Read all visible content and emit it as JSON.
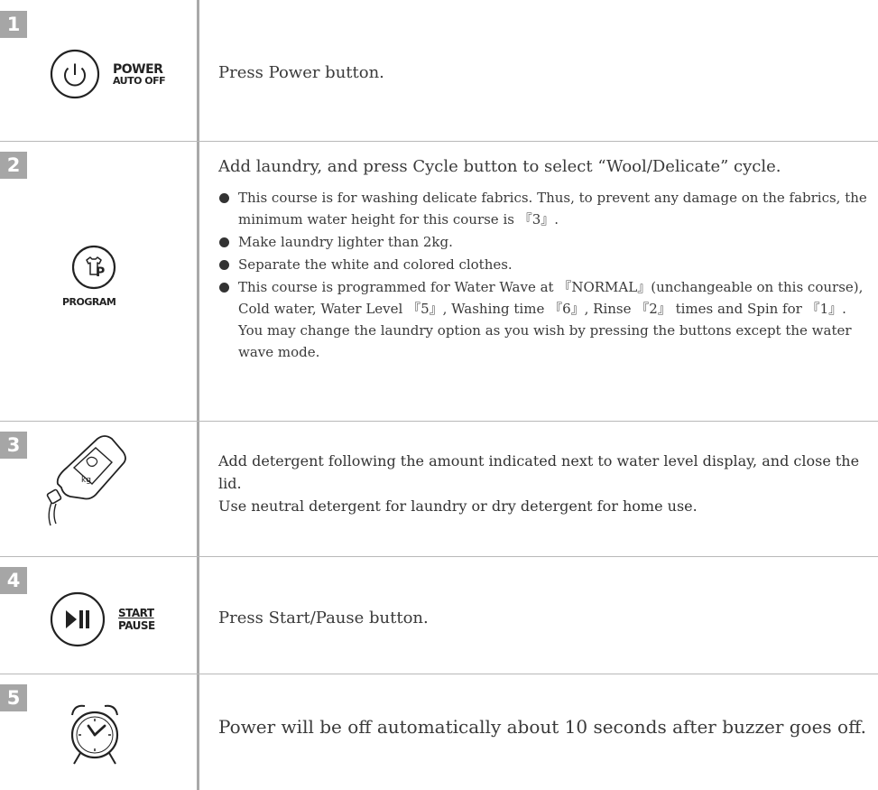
{
  "steps": [
    {
      "number": "1",
      "icon": "power-button-icon",
      "button_label_top": "POWER",
      "button_label_bottom": "AUTO OFF",
      "text": "Press Power button."
    },
    {
      "number": "2",
      "icon": "program-button-icon",
      "button_label": "PROGRAM",
      "text": "Add laundry, and press Cycle button to select “Wool/Delicate” cycle.",
      "bullets": [
        "This course is for washing delicate fabrics. Thus, to prevent any damage on the fabrics, the minimum water height for this course is 『3』.",
        "Make laundry lighter than 2kg.",
        "Separate the white and colored clothes.",
        "This course is programmed for Water Wave at 『NORMAL』(unchangeable on this course), Cold water, Water Level 『5』, Washing time 『6』, Rinse 『2』 times and Spin for 『1』. You may change the laundry option as you wish by pressing the buttons except the water wave mode."
      ]
    },
    {
      "number": "3",
      "icon": "detergent-bottle-icon",
      "text_lines": [
        "Add detergent following the amount indicated next to water level display, and close the lid.",
        "Use neutral detergent for laundry or dry detergent for home use."
      ]
    },
    {
      "number": "4",
      "icon": "start-pause-button-icon",
      "button_label_top": "START",
      "button_label_bottom": "PAUSE",
      "text": "Press Start/Pause button."
    },
    {
      "number": "5",
      "icon": "alarm-clock-icon",
      "text": "Power will be off automatically about 10 seconds after buzzer goes off."
    }
  ]
}
